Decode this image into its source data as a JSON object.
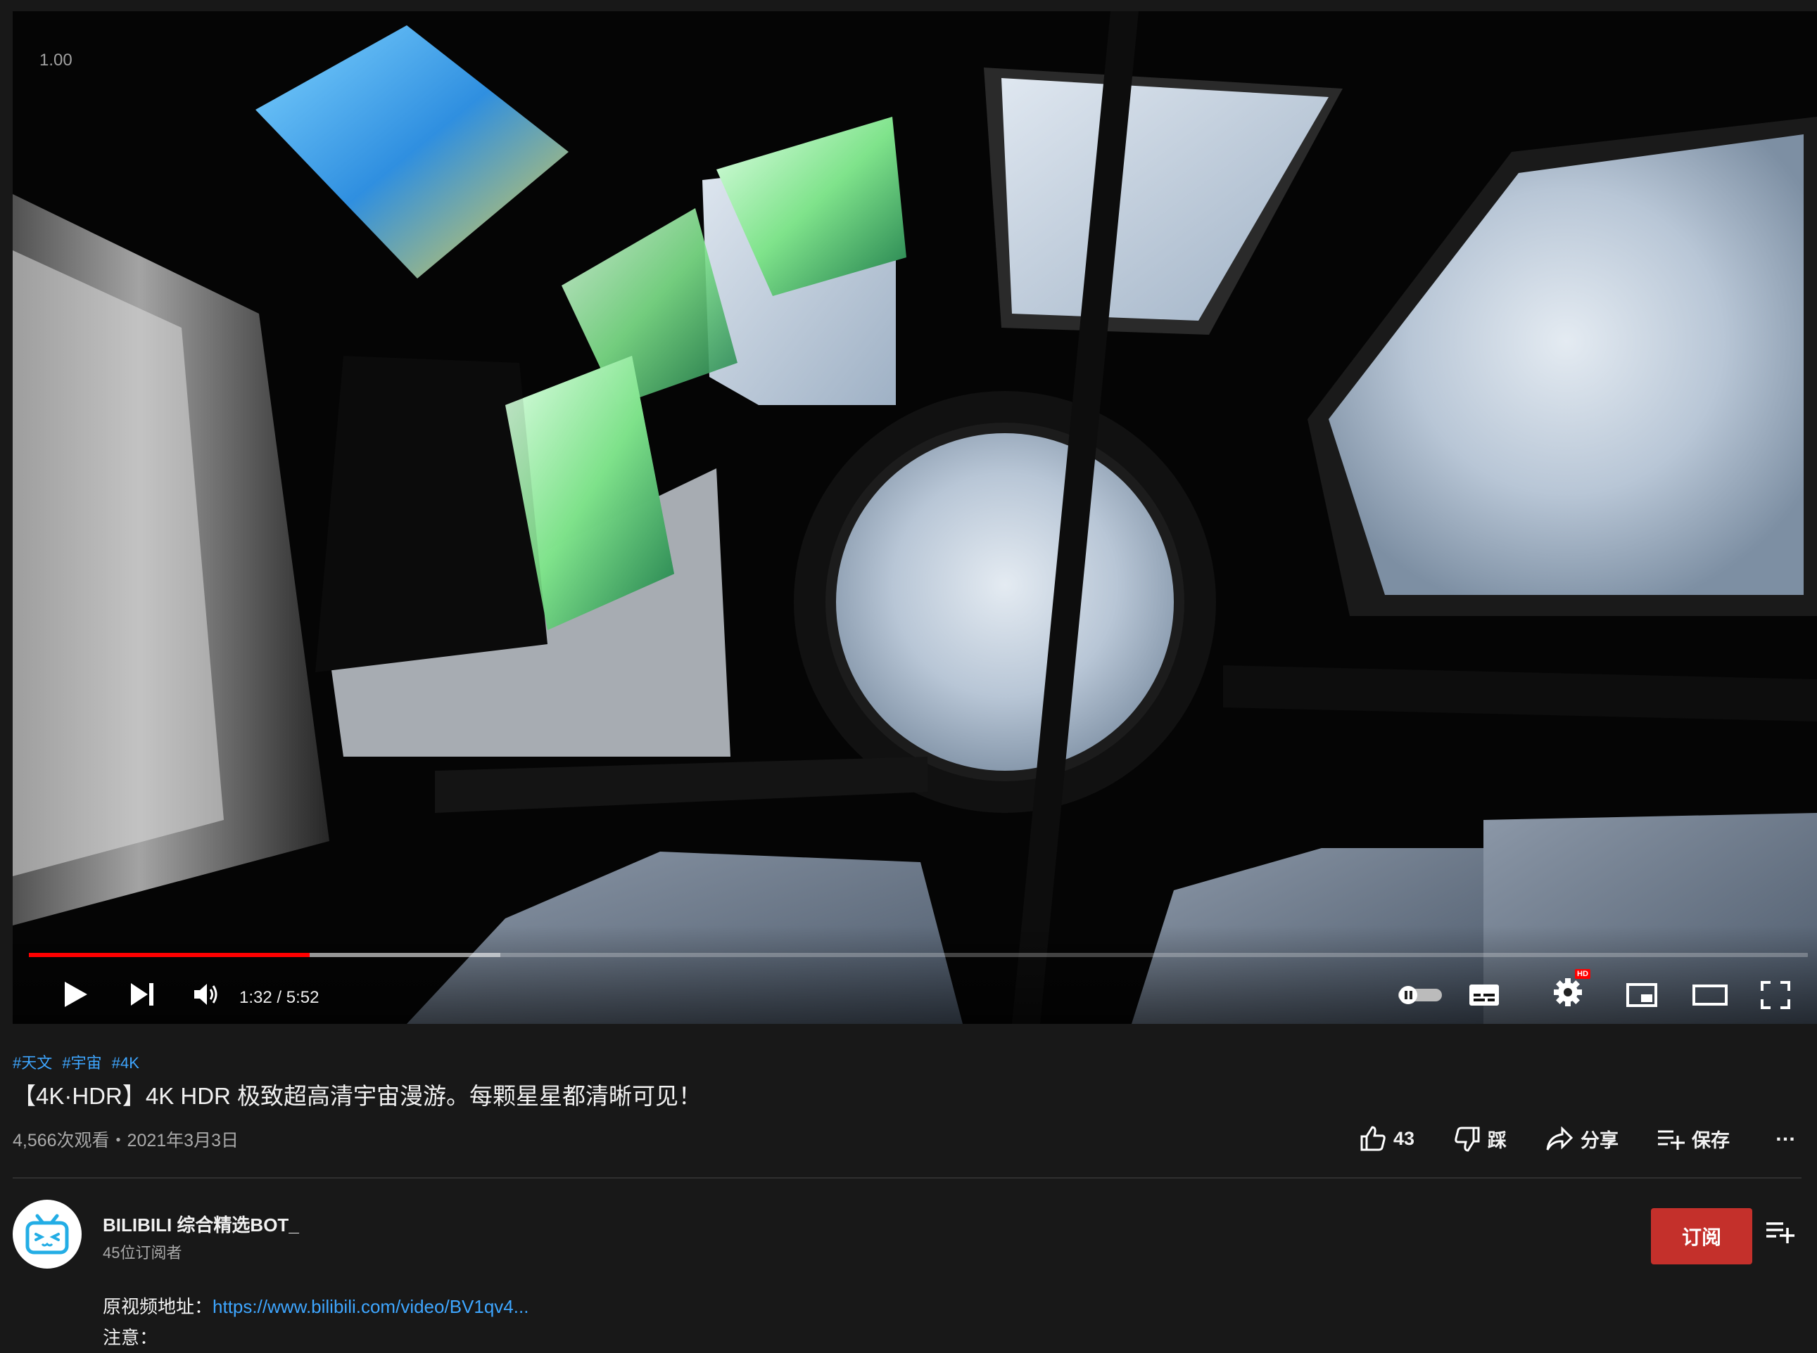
{
  "player": {
    "speed_label": "1.00",
    "time_display": "1:32 / 5:52",
    "progress_played": 0.158,
    "progress_buffered": 0.265,
    "accent_color": "#ff0000",
    "icons": {
      "play": "play-icon",
      "next": "next-icon",
      "volume": "volume-icon",
      "autoplay": "autoplay-toggle-icon",
      "subtitles": "subtitles-icon",
      "settings": "settings-gear-icon",
      "settings_badge": "HD",
      "miniplayer": "miniplayer-icon",
      "theater": "theater-mode-icon",
      "fullscreen": "fullscreen-icon"
    }
  },
  "video": {
    "tags": [
      "#天文",
      "#宇宙",
      "#4K"
    ],
    "title": "【4K·HDR】4K HDR 极致超高清宇宙漫游。每颗星星都清晰可见！",
    "views_date": "4,566次观看・2021年3月3日"
  },
  "actions": {
    "like_count": "43",
    "dislike_label": "踩",
    "share_label": "分享",
    "save_label": "保存",
    "more_label": "…"
  },
  "channel": {
    "name": "BILIBILI 综合精选BOT_",
    "subscribers": "45位订阅者",
    "subscribe_label": "订阅",
    "subscribe_color": "#c4302b"
  },
  "description": {
    "source_label": "原视频地址：",
    "source_link": "https://www.bilibili.com/video/BV1qv4...",
    "note_label": "注意："
  }
}
